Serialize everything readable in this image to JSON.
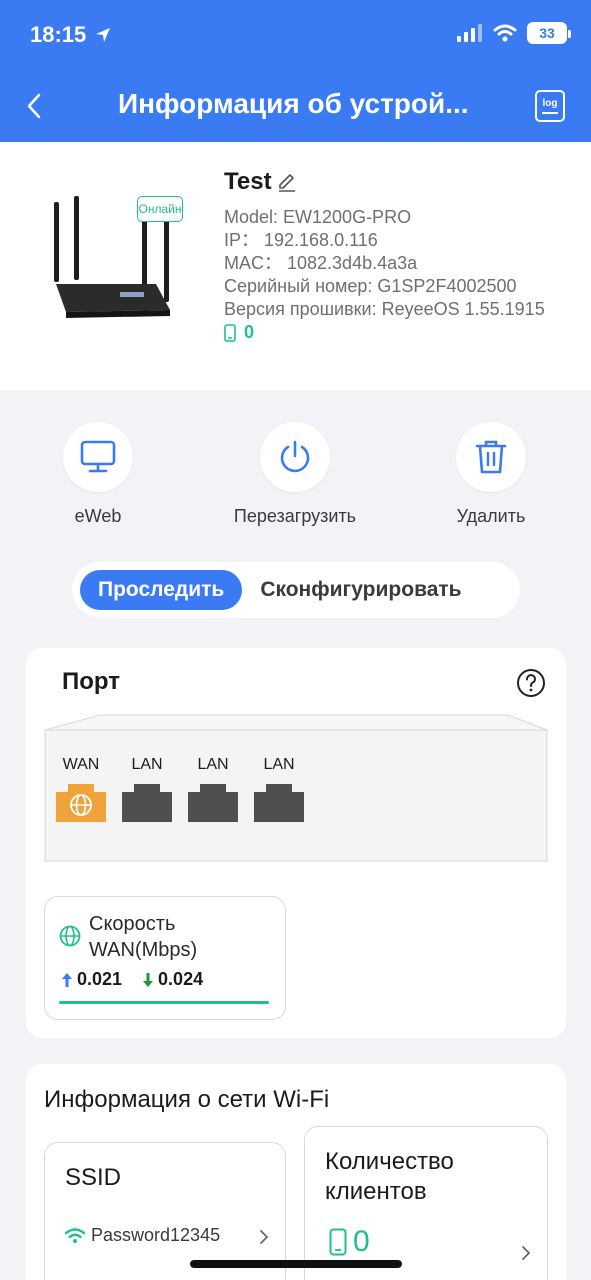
{
  "status_bar": {
    "time": "18:15",
    "battery": "33"
  },
  "header": {
    "title": "Информация об устрой...",
    "log_label": "log"
  },
  "device": {
    "name": "Test",
    "status_badge": "Онлайн",
    "model": "Model: EW1200G-PRO",
    "ip": "IP： 192.168.0.116",
    "mac": "MAC： 1082.3d4b.4a3a",
    "serial": "Серийный номер: G1SP2F4002500",
    "firmware": "Версия прошивки: ReyeeOS 1.55.1915",
    "clients": "0"
  },
  "actions": [
    {
      "label": "eWeb",
      "icon": "monitor-icon"
    },
    {
      "label": "Перезагрузить",
      "icon": "power-icon"
    },
    {
      "label": "Удалить",
      "icon": "trash-icon"
    }
  ],
  "tabs": {
    "monitor": "Проследить",
    "configure": "Сконфигурировать"
  },
  "port": {
    "title": "Порт",
    "ports": [
      "WAN",
      "LAN",
      "LAN",
      "LAN"
    ],
    "speed_title_1": "Скорость",
    "speed_title_2": "WAN(Mbps)",
    "upload": "0.021",
    "download": "0.024"
  },
  "wifi": {
    "title": "Информация о сети Wi-Fi",
    "ssid_title": "SSID",
    "ssid_value": "Password12345",
    "clients_title_1": "Количество",
    "clients_title_2": "клиентов",
    "clients_value": "0"
  },
  "colors": {
    "accent": "#3a7bf3",
    "online": "#1fbf8f",
    "wan": "#f0a33a",
    "lan": "#4f4f4f"
  }
}
